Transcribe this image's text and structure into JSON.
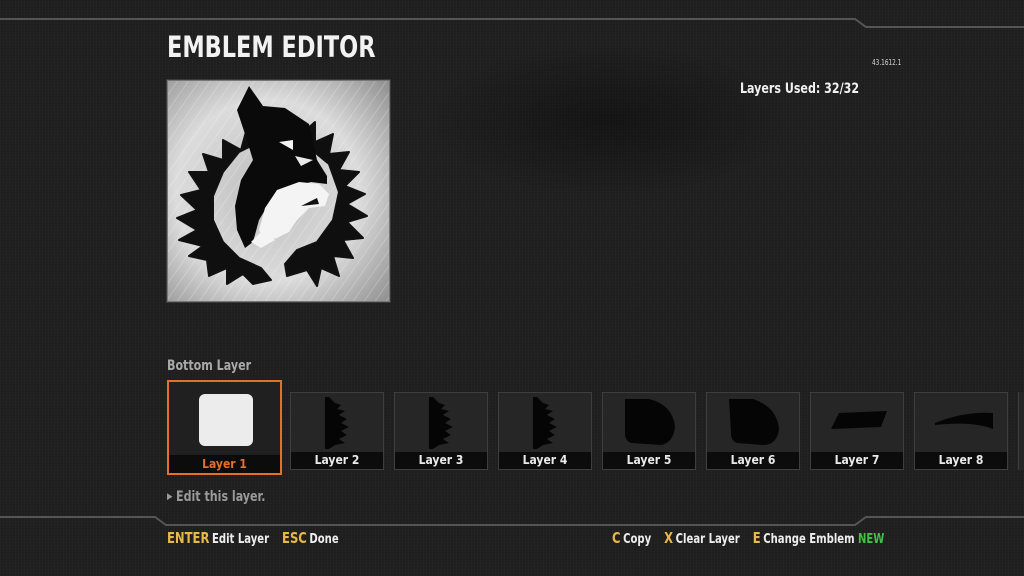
{
  "header": {
    "title": "EMBLEM EDITOR",
    "version": "43.1612.1",
    "layers_used": "Layers Used: 32/32"
  },
  "emblem": {
    "preview_icon": "wolf-emblem-icon"
  },
  "layer_strip": {
    "section_label": "Bottom Layer",
    "layers": [
      {
        "label": "Layer 1",
        "icon": "white-square-shape-icon",
        "selected": true
      },
      {
        "label": "Layer 2",
        "icon": "jagged-fur-shape-icon"
      },
      {
        "label": "Layer 3",
        "icon": "jagged-fur-shape-icon"
      },
      {
        "label": "Layer 4",
        "icon": "jagged-fur-shape-icon"
      },
      {
        "label": "Layer 5",
        "icon": "rounded-blob-shape-icon"
      },
      {
        "label": "Layer 6",
        "icon": "rounded-blob-shape-icon"
      },
      {
        "label": "Layer 7",
        "icon": "trapezoid-shape-icon"
      },
      {
        "label": "Layer 8",
        "icon": "swoosh-shape-icon"
      }
    ],
    "hint": "Edit this layer.",
    "selected_color": "#e66f2a"
  },
  "footer": {
    "left": [
      {
        "key": "ENTER",
        "label": "Edit Layer"
      },
      {
        "key": "ESC",
        "label": "Done"
      }
    ],
    "right": [
      {
        "key": "C",
        "label": "Copy"
      },
      {
        "key": "X",
        "label": "Clear Layer"
      },
      {
        "key": "E",
        "label": "Change Emblem"
      }
    ],
    "new_badge": "NEW",
    "key_color": "#e9b84a",
    "new_color": "#3fc23f"
  }
}
